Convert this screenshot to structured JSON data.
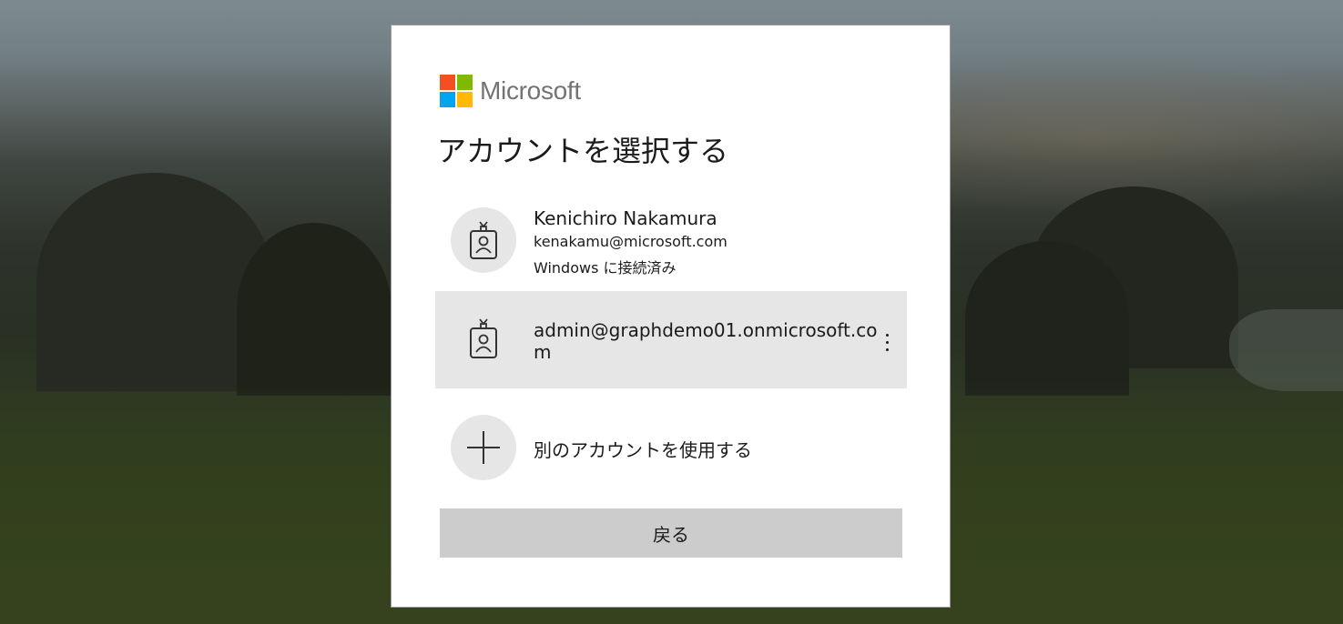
{
  "brand": {
    "name": "Microsoft",
    "logo_colors": [
      "#f25022",
      "#7fba00",
      "#00a4ef",
      "#ffb900"
    ]
  },
  "title": "アカウントを選択する",
  "accounts": [
    {
      "name": "Kenichiro Nakamura",
      "email": "kenakamu@microsoft.com",
      "status": "Windows に接続済み",
      "icon": "badge-person-icon",
      "selected": false
    },
    {
      "name": "admin@graphdemo01.onmicrosoft.com",
      "icon": "badge-person-icon",
      "selected": true,
      "menu_icon": "more-vertical-icon"
    }
  ],
  "other_account": {
    "label": "別のアカウントを使用する",
    "icon": "plus-icon"
  },
  "back_button": "戻る",
  "colors": {
    "selected_tile_bg": "#e6e6e6",
    "button_bg": "#cccccc"
  }
}
